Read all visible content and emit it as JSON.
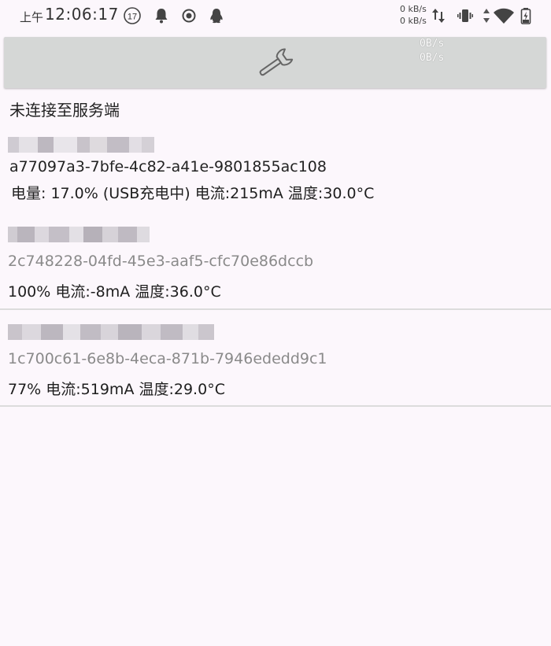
{
  "status_bar": {
    "ampm": "上午",
    "time": "12:06:17",
    "notification_count": "17",
    "net_up": "0 kB/s",
    "net_down": "0 kB/s",
    "icons": [
      "notification-count-icon",
      "bell-icon",
      "record-icon",
      "qq-icon",
      "data-arrows-icon",
      "vibrate-icon",
      "signal-arrows-icon",
      "wifi-icon",
      "battery-charging-icon"
    ]
  },
  "toolbar": {
    "speed_up": "0B/s",
    "speed_down": "0B/s",
    "icon": "wrench-icon"
  },
  "connection_status": "未连接至服务端",
  "devices": [
    {
      "id": "a77097a3-7bfe-4c82-a41e-9801855ac108",
      "info": "电量: 17.0% (USB充电中) 电流:215mA 温度:30.0°C",
      "id_color": "#222222"
    },
    {
      "id": "2c748228-04fd-45e3-aaf5-cfc70e86dccb",
      "info": "100% 电流:-8mA 温度:36.0°C",
      "id_color": "#8a8a8a"
    },
    {
      "id": "1c700c61-6e8b-4eca-871b-7946ededd9c1",
      "info": "77% 电流:519mA 温度:29.0°C",
      "id_color": "#8a8a8a"
    }
  ]
}
